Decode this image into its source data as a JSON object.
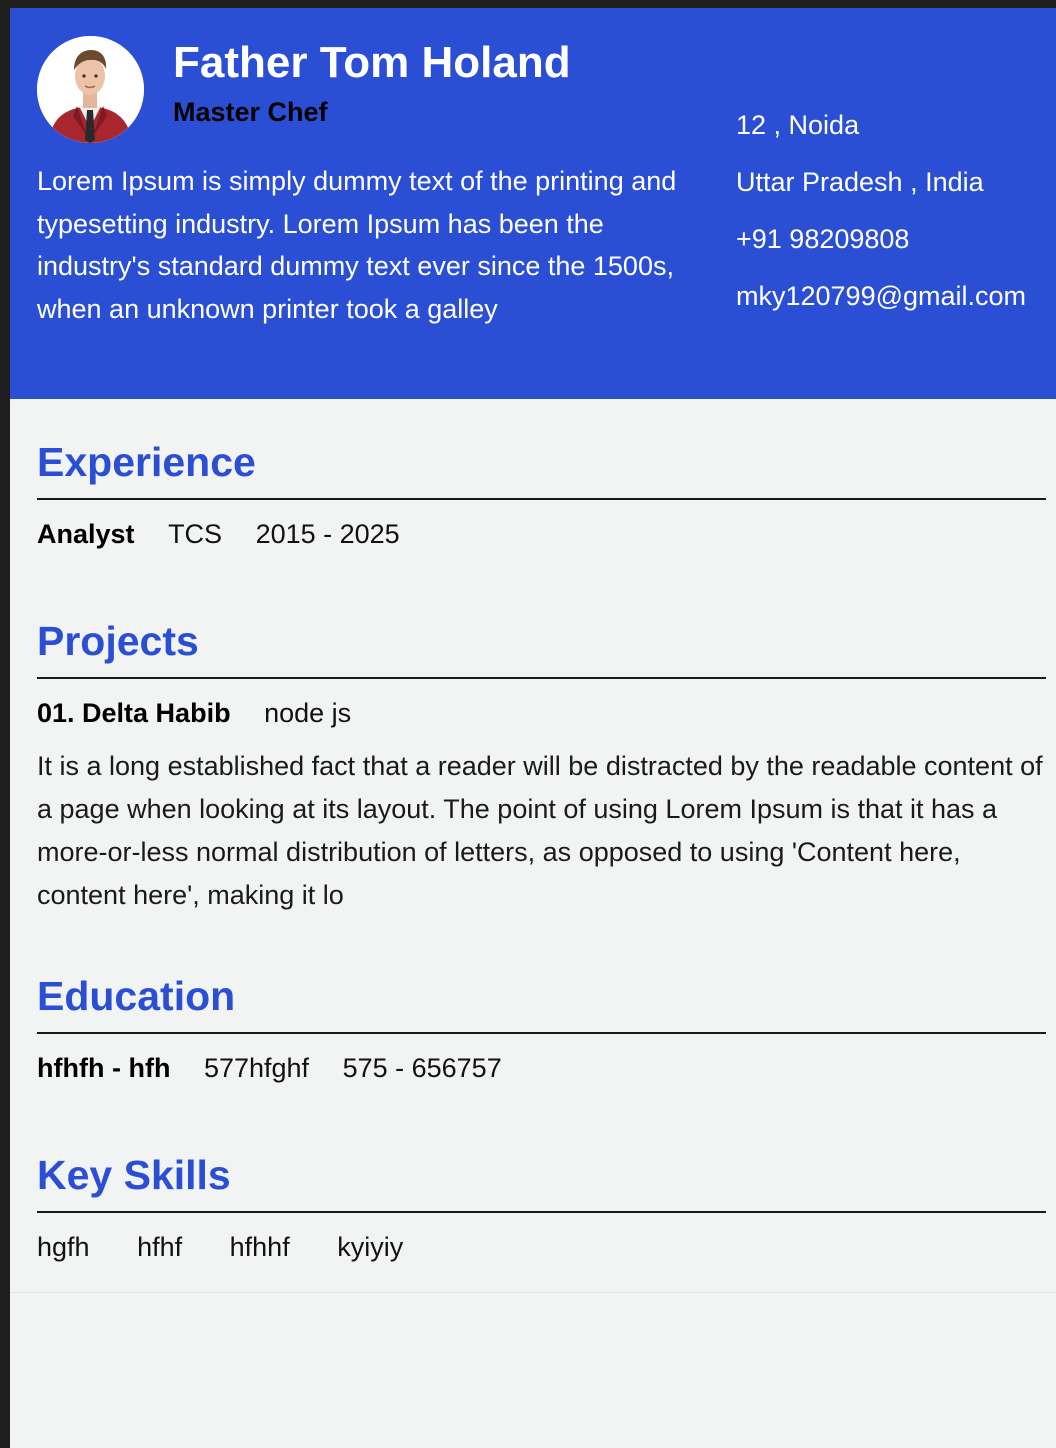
{
  "profile": {
    "name": "Father Tom Holand",
    "role": "Master Chef",
    "summary": "Lorem Ipsum is simply dummy text of the printing and typesetting industry. Lorem Ipsum has been the industry's standard dummy text ever since the 1500s, when an unknown printer took a galley"
  },
  "contact": {
    "address_line1": "12 , Noida",
    "address_line2": "Uttar Pradesh , India",
    "phone": "+91 98209808",
    "email": "mky120799@gmail.com"
  },
  "experience": {
    "heading": "Experience",
    "items": [
      {
        "title": "Analyst",
        "company": "TCS",
        "years": "2015 - 2025"
      }
    ]
  },
  "projects": {
    "heading": "Projects",
    "items": [
      {
        "title": "01. Delta Habib",
        "tech": "node js",
        "description": "It is a long established fact that a reader will be distracted by the readable content of a page when looking at its layout. The point of using Lorem Ipsum is that it has a more-or-less normal distribution of letters, as opposed to using 'Content here, content here', making it lo"
      }
    ]
  },
  "education": {
    "heading": "Education",
    "items": [
      {
        "degree": "hfhfh - hfh",
        "school": "577hfghf",
        "years": "575 - 656757"
      }
    ]
  },
  "skills": {
    "heading": "Key Skills",
    "items": [
      "hgfh",
      "hfhf",
      "hfhhf",
      "kyiyiy"
    ]
  },
  "colors": {
    "accent": "#2b4fd4",
    "background": "#f2f3f3",
    "text": "#111111"
  }
}
